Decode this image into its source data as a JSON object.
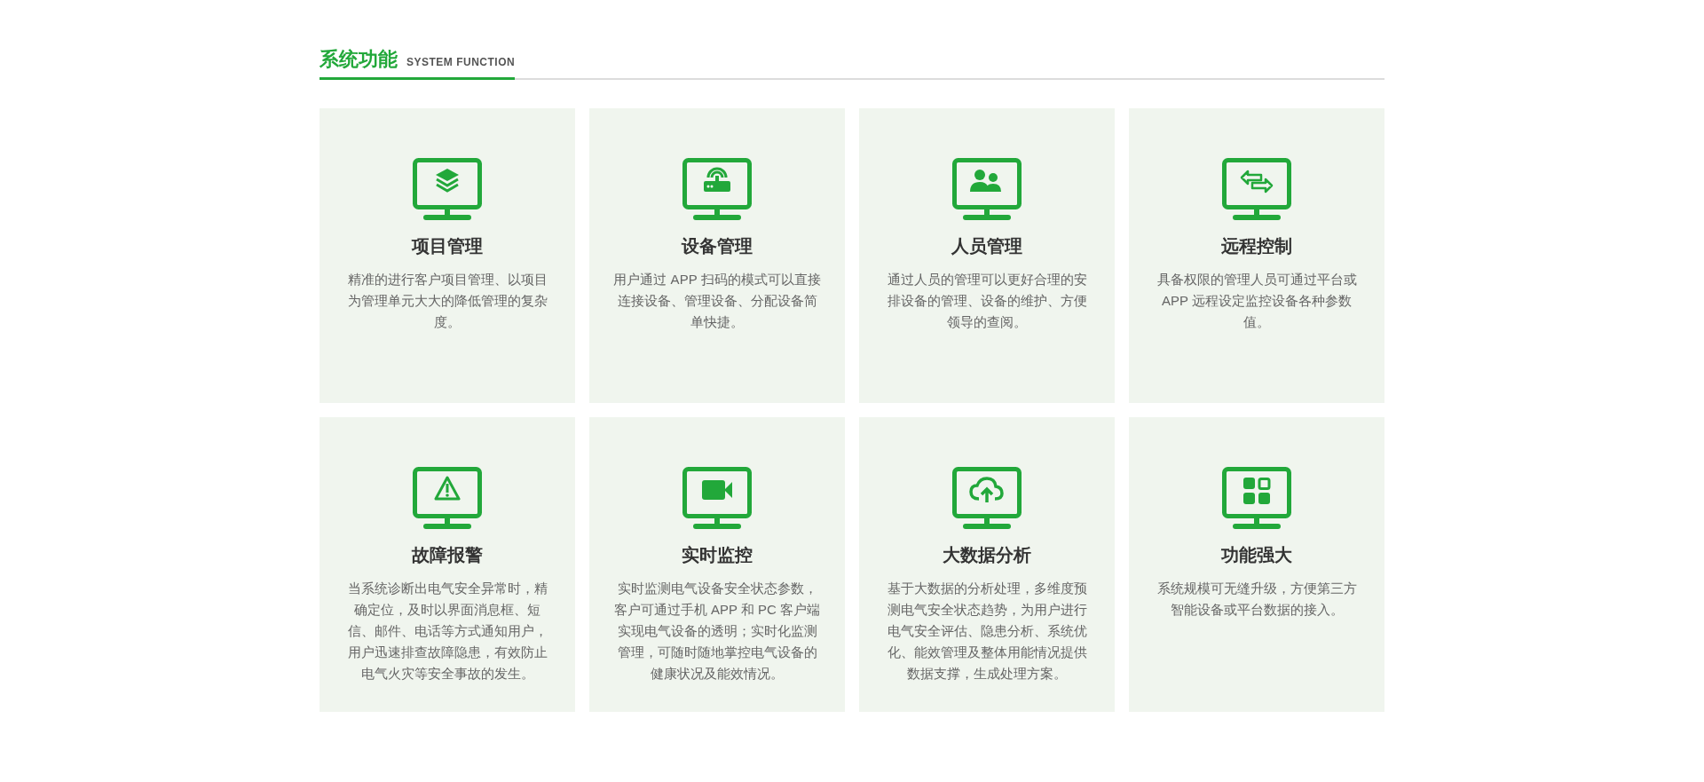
{
  "section_header": {
    "title": "系统功能",
    "subtitle": "SYSTEM FUNCTION"
  },
  "features": [
    {
      "kind": "layers",
      "title": "项目管理",
      "description": "精准的进行客户项目管理、以项目为管理单元大大的降低管理的复杂度。"
    },
    {
      "kind": "router",
      "title": "设备管理",
      "description": "用户通过 APP 扫码的模式可以直接连接设备、管理设备、分配设备简单快捷。"
    },
    {
      "kind": "users",
      "title": "人员管理",
      "description": "通过人员的管理可以更好合理的安排设备的管理、设备的维护、方便领导的查阅。"
    },
    {
      "kind": "arrows",
      "title": "远程控制",
      "description": "具备权限的管理人员可通过平台或 APP 远程设定监控设备各种参数值。"
    },
    {
      "kind": "warning",
      "title": "故障报警",
      "description": "当系统诊断出电气安全异常时，精确定位，及时以界面消息框、短信、邮件、电话等方式通知用户，用户迅速排查故障隐患，有效防止电气火灾等安全事故的发生。"
    },
    {
      "kind": "video",
      "title": "实时监控",
      "description": "实时监测电气设备安全状态参数，客户可通过手机 APP 和 PC 客户端实现电气设备的透明；实时化监测管理，可随时随地掌控电气设备的健康状况及能效情况。"
    },
    {
      "kind": "cloud",
      "title": "大数据分析",
      "description": "基于大数据的分析处理，多维度预测电气安全状态趋势，为用户进行电气安全评估、隐患分析、系统优化、能效管理及整体用能情况提供数据支撑，生成处理方案。"
    },
    {
      "kind": "apps",
      "title": "功能强大",
      "description": "系统规模可无缝升级，方便第三方智能设备或平台数据的接入。"
    }
  ]
}
